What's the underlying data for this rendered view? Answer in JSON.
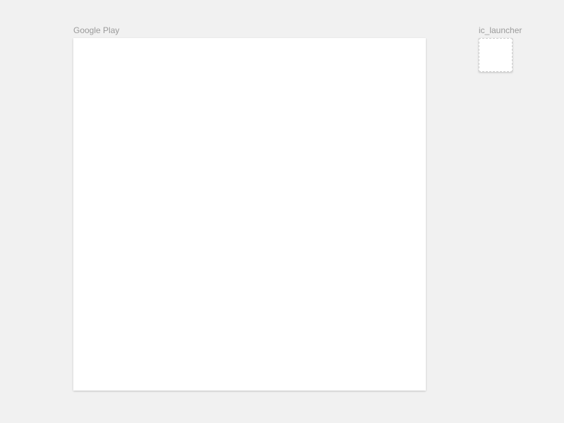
{
  "panels": {
    "main": {
      "label": "Google Play"
    },
    "icon": {
      "label": "ic_launcher"
    }
  }
}
